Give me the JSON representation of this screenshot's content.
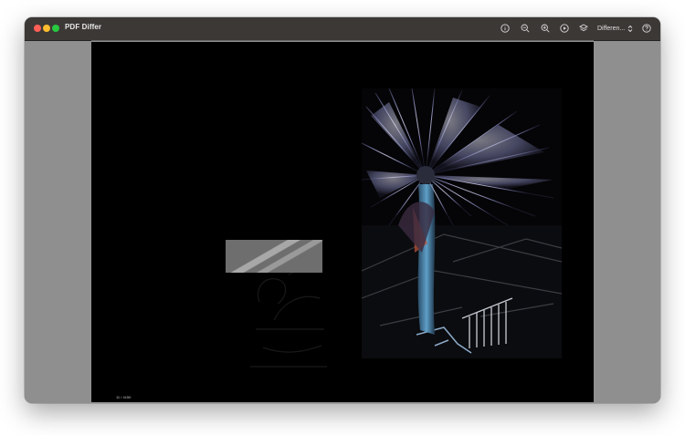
{
  "app": {
    "title": "PDF Differ"
  },
  "toolbar": {
    "info_icon": "info-icon",
    "zoom_out_icon": "zoom-out-icon",
    "zoom_in_icon": "zoom-in-icon",
    "play_icon": "play-icon",
    "layers_icon": "layers-icon",
    "help_icon": "help-icon",
    "mode": {
      "selected": "Differen..."
    }
  },
  "document": {
    "page_indicator": "11 / 4150"
  }
}
